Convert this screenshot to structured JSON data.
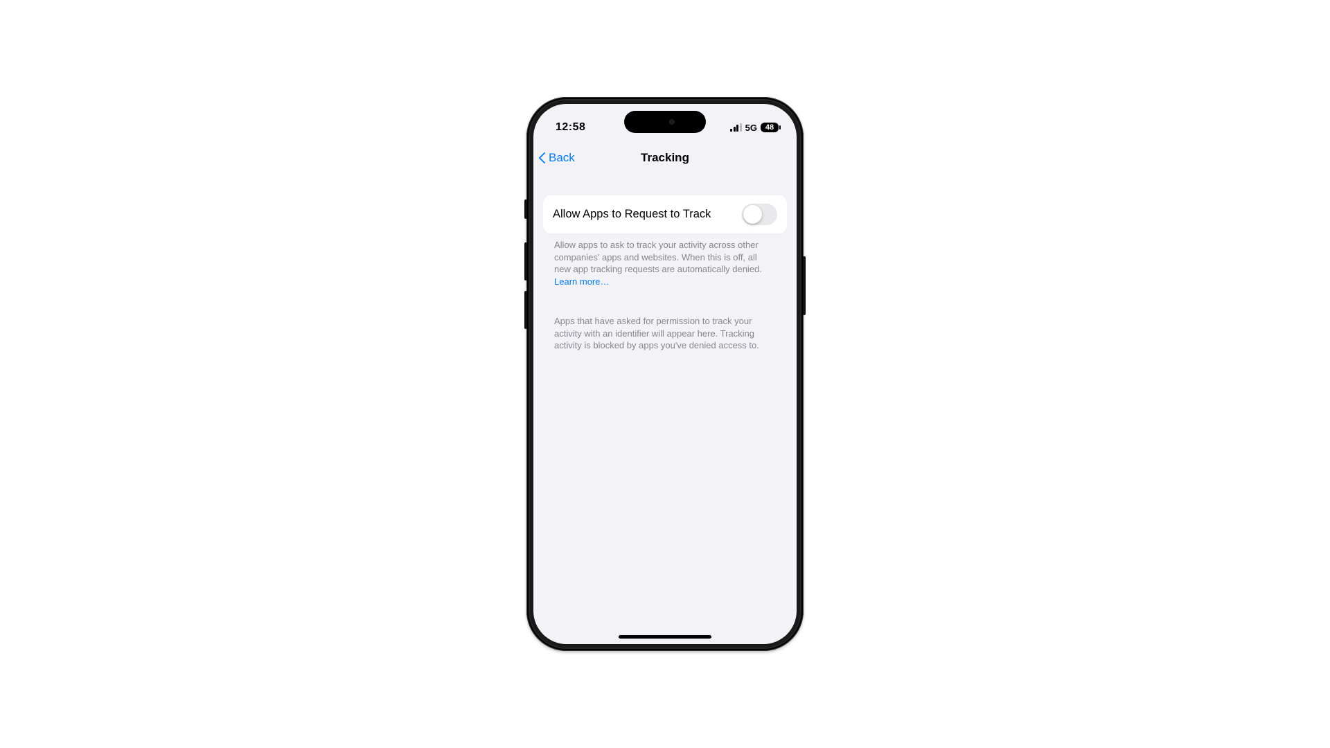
{
  "status": {
    "time": "12:58",
    "cellular_label": "5G",
    "battery_percent": "48"
  },
  "navbar": {
    "back_label": "Back",
    "title": "Tracking"
  },
  "settings": {
    "allow_track_label": "Allow Apps to Request to Track",
    "allow_track_on": false,
    "footnote1": "Allow apps to ask to track your activity across other companies' apps and websites. When this is off, all new app tracking requests are automatically denied. ",
    "learn_more": "Learn more…",
    "footnote2": "Apps that have asked for permission to track your activity with an identifier will appear here. Tracking activity is blocked by apps you've denied access to."
  }
}
